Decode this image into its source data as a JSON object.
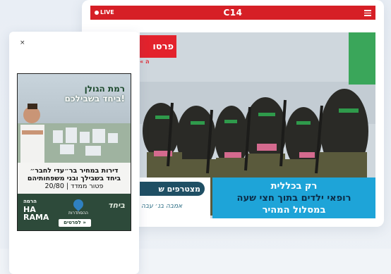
{
  "header": {
    "live_label": "LIVE",
    "logo": "C14",
    "menu_icon": "hamburger-icon"
  },
  "hero": {
    "tag": "פרסו",
    "tag_sub": "« ה"
  },
  "banner": {
    "pill": "מצטרפים ש",
    "script": "אמבה בנ׳ עבה",
    "line1": "רק בכללית",
    "line2": "רופאי ילדים בתוך חצי שעה",
    "line3": "במסלול המהיר"
  },
  "ad": {
    "close_label": "×",
    "heading1": "רמת הגולן",
    "heading2": "ביחד בשבילכם!",
    "text1": "דירות במחיר בר״עדי לחבר״",
    "text2": "ביחד בשבילך ובני משפחותיהם",
    "text3": "פטור ממדד | 20/80",
    "rama_he": "הרמה",
    "rama_en1": "HA",
    "rama_en2": "RAMA",
    "mid_label": "ההסתדרות",
    "yahad": "ביחד",
    "cta": "לפרטים »"
  },
  "colors": {
    "brand_red": "#d61f26",
    "banner_blue": "#1ea4d8",
    "ad_green": "#2d4a3a"
  }
}
